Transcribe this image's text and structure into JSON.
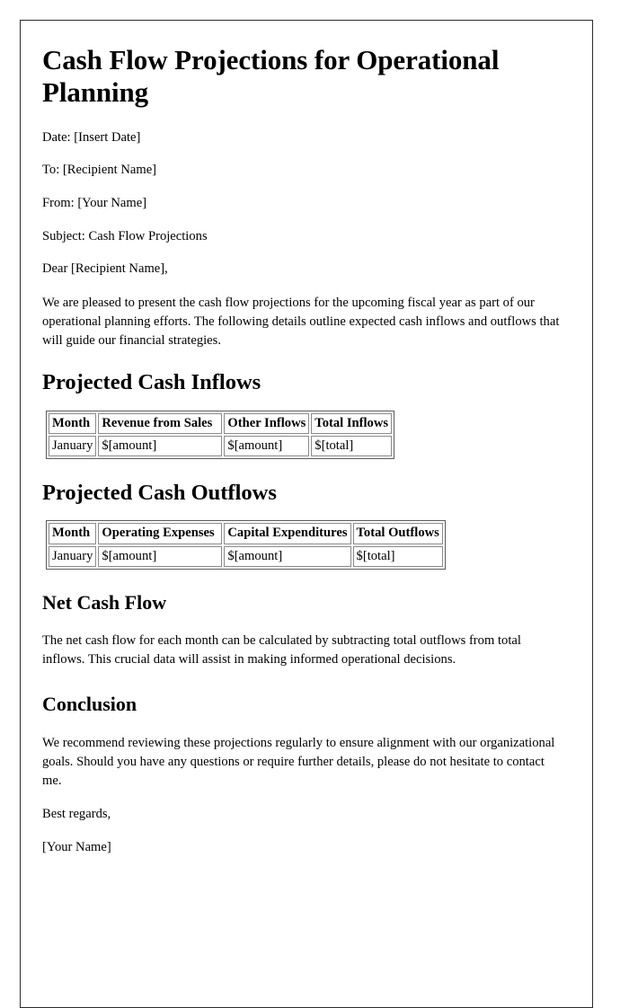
{
  "document": {
    "title": "Cash Flow Projections for Operational Planning",
    "meta": [
      "Date: [Insert Date]",
      "To: [Recipient Name]",
      "From: [Your Name]",
      "Subject: Cash Flow Projections",
      "Dear [Recipient Name],"
    ],
    "intro_paragraph": "We are pleased to present the cash flow projections for the upcoming fiscal year as part of our operational planning efforts. The following details outline expected cash inflows and outflows that will guide our financial strategies.",
    "sections": {
      "inflows": {
        "heading": "Projected Cash Inflows",
        "table": {
          "headers": [
            "Month",
            "Revenue from Sales",
            "Other Inflows",
            "Total Inflows"
          ],
          "rows": [
            [
              "January",
              "$[amount]",
              "$[amount]",
              "$[total]"
            ]
          ]
        }
      },
      "outflows": {
        "heading": "Projected Cash Outflows",
        "table": {
          "headers": [
            "Month",
            "Operating Expenses",
            "Capital Expenditures",
            "Total Outflows"
          ],
          "rows": [
            [
              "January",
              "$[amount]",
              "$[amount]",
              "$[total]"
            ]
          ]
        }
      },
      "net_cash_flow": {
        "heading": "Net Cash Flow",
        "paragraph": "The net cash flow for each month can be calculated by subtracting total outflows from total inflows. This crucial data will assist in making informed operational decisions."
      },
      "conclusion": {
        "heading": "Conclusion",
        "paragraph": "We recommend reviewing these projections regularly to ensure alignment with our organizational goals. Should you have any questions or require further details, please do not hesitate to contact me."
      }
    },
    "closing": {
      "salutation": "Best regards,",
      "signature": "[Your Name]"
    }
  },
  "colors": {
    "text": "#000000",
    "page_border": "#2b2b2b",
    "table_outer_border": "#5b5b5b",
    "table_cell_border": "#8a8a8a",
    "background": "#ffffff"
  }
}
